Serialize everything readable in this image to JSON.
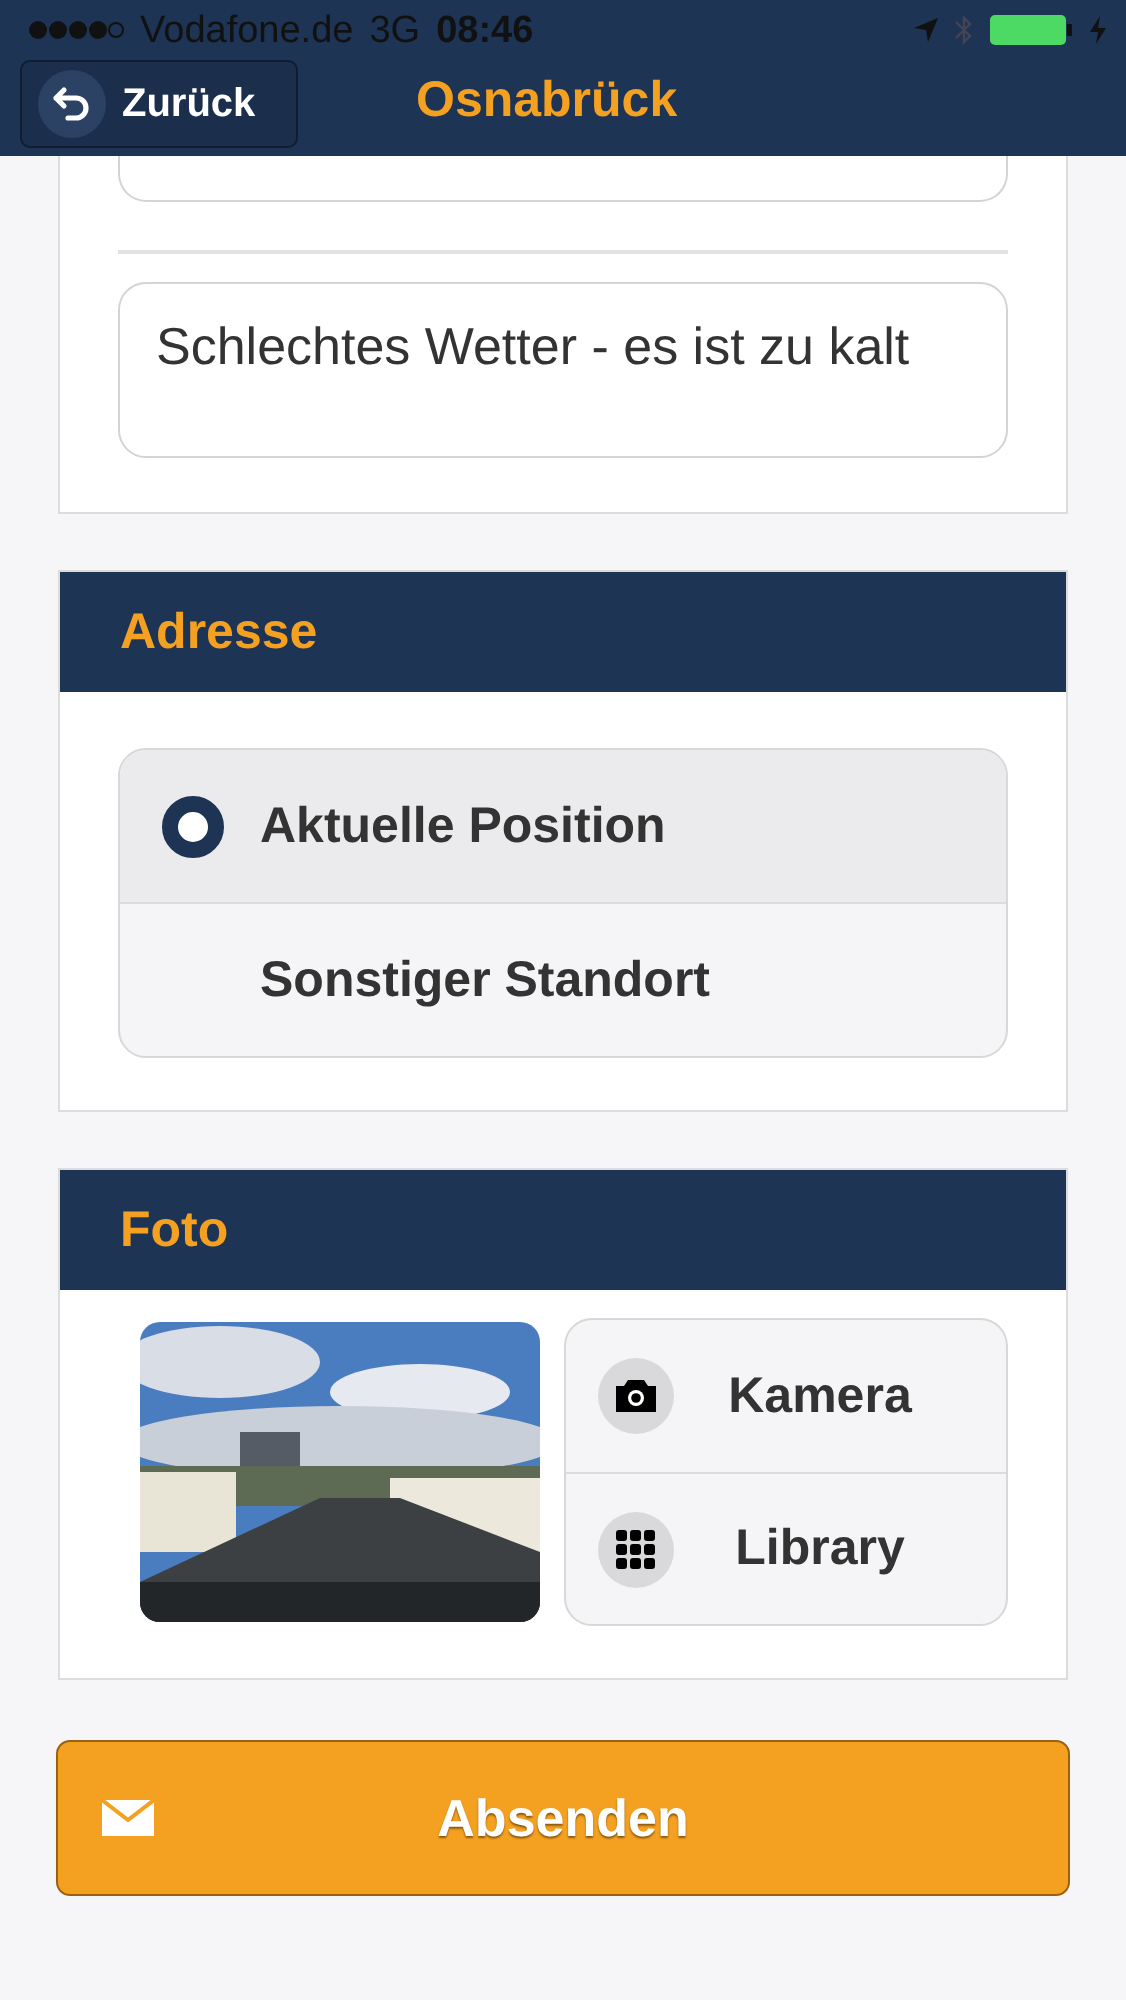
{
  "status_bar": {
    "carrier": "Vodafone.de",
    "network": "3G",
    "time": "08:46"
  },
  "nav": {
    "back": "Zurück",
    "title": "Osnabrück"
  },
  "reason": {
    "value": "Schlechtes Wetter - es ist zu kalt"
  },
  "address": {
    "title": "Adresse",
    "options": [
      {
        "label": "Aktuelle Position",
        "selected": true
      },
      {
        "label": "Sonstiger Standort",
        "selected": false
      }
    ]
  },
  "photo": {
    "title": "Foto",
    "buttons": [
      {
        "kind": "camera",
        "label": "Kamera"
      },
      {
        "kind": "library",
        "label": "Library"
      }
    ]
  },
  "submit": {
    "label": "Absenden"
  }
}
